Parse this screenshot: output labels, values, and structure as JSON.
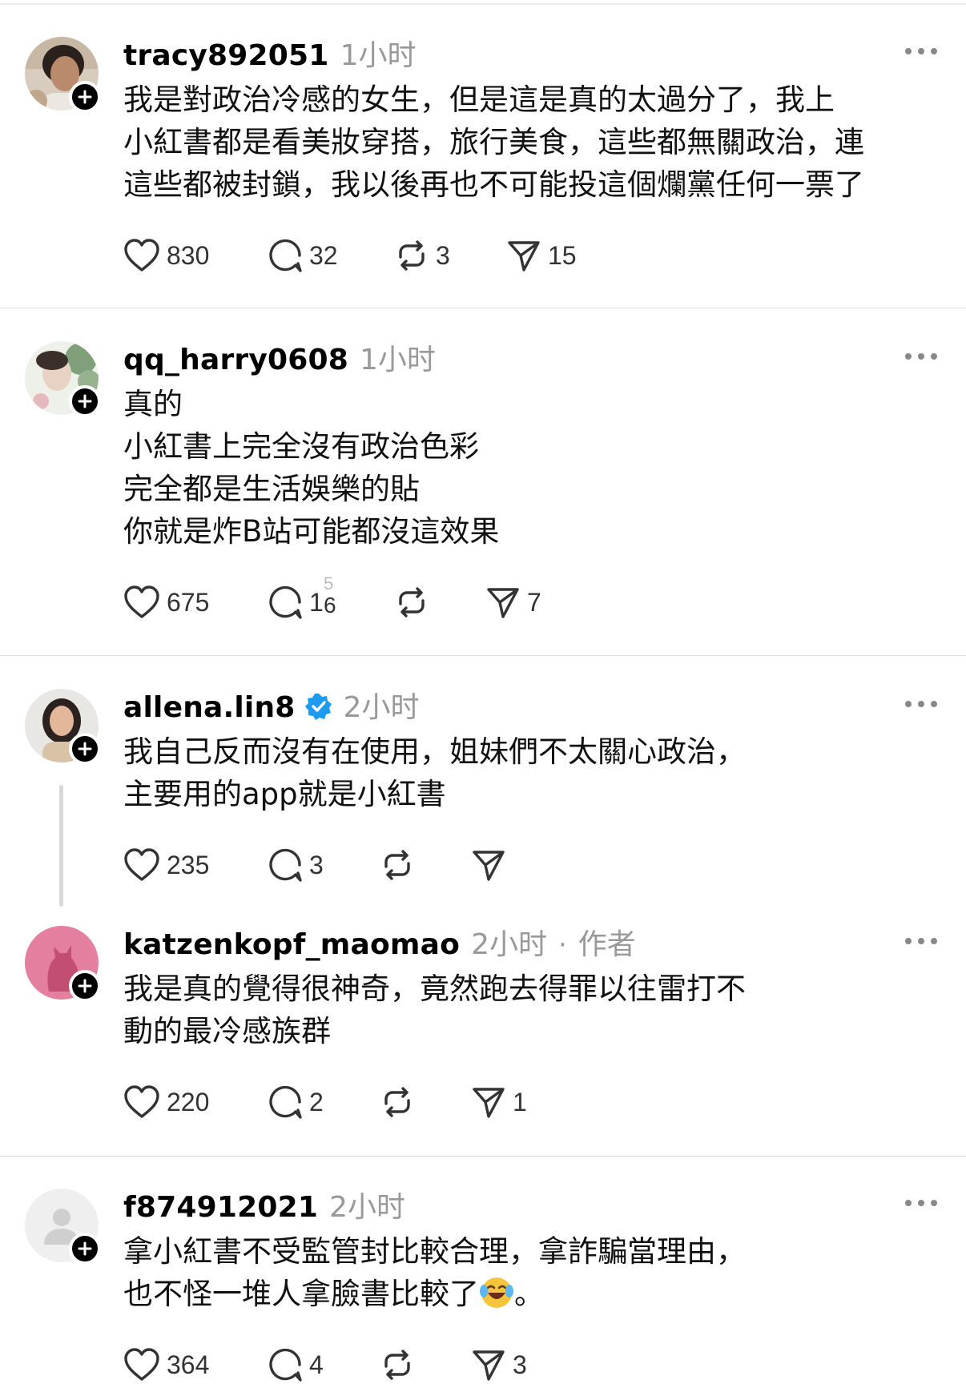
{
  "posts": [
    {
      "username": "tracy892051",
      "time": "1小时",
      "lines": [
        "我是對政治冷感的女生，但是這是真的太過分了，我上",
        "小紅書都是看美妝穿搭，旅行美食，這些都無關政治，連",
        "這些都被封鎖，我以後再也不可能投這個爛黨任何一票了"
      ],
      "likes": "830",
      "replies": "32",
      "reposts": "3",
      "shares": "15"
    },
    {
      "username": "qq_harry0608",
      "time": "1小时",
      "lines": [
        "真的",
        "小紅書上完全沒有政治色彩",
        "完全都是生活娛樂的貼",
        "你就是炸B站可能都沒這效果"
      ],
      "likes": "675",
      "replies_rolling_top": "5",
      "replies_prefix": "1",
      "replies_rolling_bottom": "6",
      "reposts": "",
      "shares": "7"
    },
    {
      "username": "allena.lin8",
      "verified": true,
      "time": "2小时",
      "lines": [
        "我自己反而沒有在使用，姐妹們不太關心政治，",
        "主要用的app就是小紅書"
      ],
      "likes": "235",
      "replies": "3",
      "reposts": "",
      "shares": ""
    },
    {
      "username": "katzenkopf_maomao",
      "time": "2小时",
      "separator": "·",
      "tag": "作者",
      "lines": [
        "我是真的覺得很神奇，竟然跑去得罪以往雷打不",
        "動的最冷感族群"
      ],
      "likes": "220",
      "replies": "2",
      "reposts": "",
      "shares": "1"
    },
    {
      "username": "f874912021",
      "time": "2小时",
      "lines": [
        "拿小紅書不受監管封比較合理，拿詐騙當理由，"
      ],
      "last_line_text": "也不怪一堆人拿臉書比較了",
      "last_line_tail": "。",
      "emoji": "face-with-tears-of-joy",
      "likes": "364",
      "replies": "4",
      "reposts": "",
      "shares": "3"
    }
  ],
  "colors": {
    "verified": "#1D9BF0",
    "timestamp": "#999999",
    "icon": "#333333",
    "divider": "#dcdcdc"
  }
}
